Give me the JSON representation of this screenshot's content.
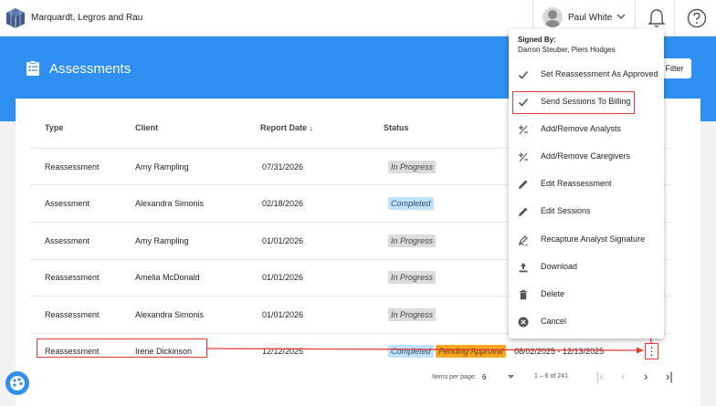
{
  "header": {
    "company": "Marquardt, Legros and Rau",
    "user_name": "Paul White"
  },
  "page": {
    "title": "Assessments",
    "filter_label": "Filter"
  },
  "table": {
    "columns": [
      "Type",
      "Client",
      "Report Date ↓",
      "Status"
    ],
    "rows": [
      {
        "type": "Reassessment",
        "client": "Amy Rampling",
        "date": "07/31/2026",
        "status": "In Progress"
      },
      {
        "type": "Assessment",
        "client": "Alexandra Simonis",
        "date": "02/18/2026",
        "status": "Completed"
      },
      {
        "type": "Assessment",
        "client": "Amy Rampling",
        "date": "01/01/2026",
        "status": "In Progress"
      },
      {
        "type": "Reassessment",
        "client": "Amelia McDonald",
        "date": "01/01/2026",
        "status": "In Progress"
      },
      {
        "type": "Reassessment",
        "client": "Alexandra Simonis",
        "date": "01/01/2026",
        "status": "In Progress"
      },
      {
        "type": "Reassessment",
        "client": "Irene Dickinson",
        "date": "12/12/2025",
        "status": "Completed",
        "status2": "Pending Approval",
        "range": "08/02/2025 - 12/13/2025"
      }
    ]
  },
  "pager": {
    "label": "Items per page:",
    "size": "6",
    "range": "1 – 6 of 241"
  },
  "menu": {
    "signed_title": "Signed By:",
    "signed_names": "Darron Steuber, Piers Hodges",
    "items": [
      {
        "label": "Set Reassessment As Approved",
        "icon": "check-icon"
      },
      {
        "label": "Send Sessions To Billing",
        "icon": "check-icon"
      },
      {
        "label": "Add/Remove Analysts",
        "icon": "plus-minus-icon"
      },
      {
        "label": "Add/Remove Caregivers",
        "icon": "plus-minus-icon"
      },
      {
        "label": "Edit Reassessment",
        "icon": "pencil-icon"
      },
      {
        "label": "Edit Sessions",
        "icon": "pencil-icon"
      },
      {
        "label": "Recapture Analyst Signature",
        "icon": "signature-icon"
      },
      {
        "label": "Download",
        "icon": "download-icon"
      },
      {
        "label": "Delete",
        "icon": "trash-icon"
      },
      {
        "label": "Cancel",
        "icon": "cancel-icon"
      }
    ]
  },
  "colors": {
    "primary": "#2f8ff0",
    "highlight": "#e53935",
    "pending": "#f5a623",
    "completed": "#bfe3ff"
  }
}
